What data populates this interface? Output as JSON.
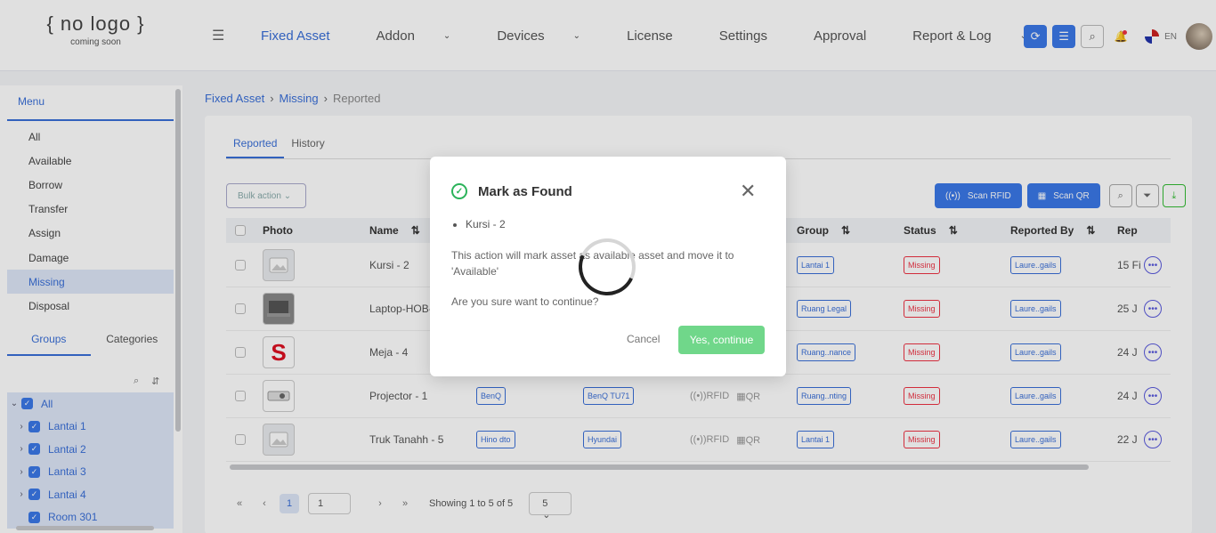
{
  "logo": {
    "line1": "{ no logo }",
    "line2": "coming soon"
  },
  "nav": [
    {
      "label": "Fixed Asset",
      "active": true,
      "dropdown": false
    },
    {
      "label": "Addon",
      "active": false,
      "dropdown": true
    },
    {
      "label": "Devices",
      "active": false,
      "dropdown": true
    },
    {
      "label": "License",
      "active": false,
      "dropdown": false
    },
    {
      "label": "Settings",
      "active": false,
      "dropdown": false
    },
    {
      "label": "Approval",
      "active": false,
      "dropdown": false
    },
    {
      "label": "Report & Log",
      "active": false,
      "dropdown": true
    }
  ],
  "header": {
    "lang": "EN"
  },
  "sidebar": {
    "menu_title": "Menu",
    "items": [
      "All",
      "Available",
      "Borrow",
      "Transfer",
      "Assign",
      "Damage",
      "Missing",
      "Disposal"
    ],
    "selected": "Missing",
    "tabs": {
      "groups": "Groups",
      "categories": "Categories"
    },
    "tree": [
      "All",
      "Lantai 1",
      "Lantai 2",
      "Lantai 3",
      "Lantai 4",
      "Room 301"
    ]
  },
  "breadcrumb": {
    "c1": "Fixed Asset",
    "c2": "Missing",
    "c3": "Reported"
  },
  "tabs": {
    "reported": "Reported",
    "history": "History"
  },
  "toolbar": {
    "bulk": "Bulk action",
    "scan_rfid": "Scan RFID",
    "scan_qr": "Scan QR"
  },
  "table": {
    "headers": {
      "photo": "Photo",
      "name": "Name",
      "group": "Group",
      "status": "Status",
      "reported_by": "Reported By",
      "rep": "Rep"
    },
    "rows": [
      {
        "name": "Kursi - 2",
        "brand": "",
        "model": "",
        "rfid": "",
        "qr": "",
        "group": "Lantai 1",
        "status": "Missing",
        "reported_by": "Laure..gails",
        "date": "15 Fi",
        "photo": "placeholder"
      },
      {
        "name": "Laptop-HOB-",
        "brand": "",
        "model": "",
        "rfid": "",
        "qr": "",
        "group": "Ruang Legal",
        "status": "Missing",
        "reported_by": "Laure..gails",
        "date": "25 J",
        "photo": "laptop"
      },
      {
        "name": "Meja - 4",
        "brand": "",
        "model": "",
        "rfid": "",
        "qr": "",
        "group": "Ruang..nance",
        "status": "Missing",
        "reported_by": "Laure..gails",
        "date": "24 J",
        "photo": "S"
      },
      {
        "name": "Projector - 1",
        "brand": "BenQ",
        "model": "BenQ TU71",
        "rfid": "RFID",
        "qr": "QR",
        "group": "Ruang..nting",
        "status": "Missing",
        "reported_by": "Laure..gails",
        "date": "24 J",
        "photo": "projector"
      },
      {
        "name": "Truk Tanahh - 5",
        "brand": "Hino dto",
        "model": "Hyundai",
        "rfid": "RFID",
        "qr": "QR",
        "group": "Lantai 1",
        "status": "Missing",
        "reported_by": "Laure..gails",
        "date": "22 J",
        "photo": "placeholder"
      }
    ]
  },
  "pager": {
    "page": "1",
    "input": "1",
    "info": "Showing 1 to 5 of 5",
    "size": "5"
  },
  "modal": {
    "title": "Mark as Found",
    "item": "Kursi - 2",
    "message": "This action will mark asset as available asset and move it to 'Available'",
    "question": "Are you sure want to continue?",
    "cancel": "Cancel",
    "confirm": "Yes, continue"
  },
  "colors": {
    "primary": "#3b78e7",
    "success": "#34c759",
    "danger": "#e34"
  }
}
